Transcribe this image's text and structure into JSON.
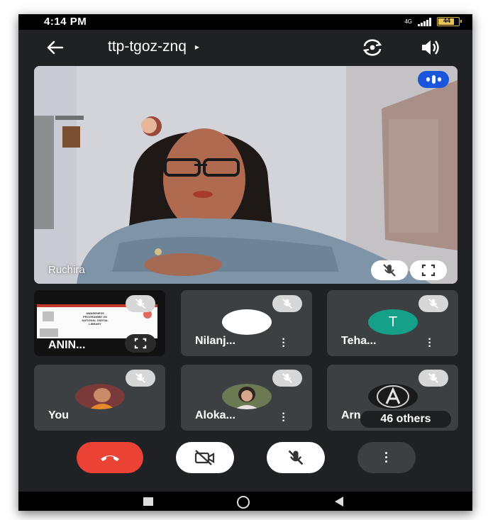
{
  "status": {
    "time": "4:14 PM",
    "network": "4G",
    "battery": "44"
  },
  "header": {
    "meeting_code": "ttp-tgoz-znq",
    "caret": "▸"
  },
  "main_speaker": {
    "name": "Ruchira"
  },
  "participants": [
    {
      "name": "ANIN...",
      "tile_type": "screen-share"
    },
    {
      "name": "Nilanj...",
      "tile_type": "avatar"
    },
    {
      "name": "Teha...",
      "tile_type": "letter",
      "initial": "T",
      "avatar_color": "#15a08a"
    },
    {
      "name": "You",
      "tile_type": "photo"
    },
    {
      "name": "Aloka...",
      "tile_type": "photo"
    },
    {
      "name": "Arn",
      "tile_type": "photo",
      "overlay": "46 others"
    }
  ],
  "shared_screen": {
    "lines": [
      "AWARENESS",
      "PROGRAMME ON",
      "NATIONAL DIGITAL",
      "LIBRARY"
    ]
  },
  "controls": {
    "end_call": "end-call",
    "camera": "camera-off",
    "mic": "mic-off",
    "more": "more-options"
  },
  "colors": {
    "end_call": "#ea4335",
    "speaking_badge": "#1a56db",
    "tile_bg": "#3c4043",
    "app_bg": "#202124"
  }
}
